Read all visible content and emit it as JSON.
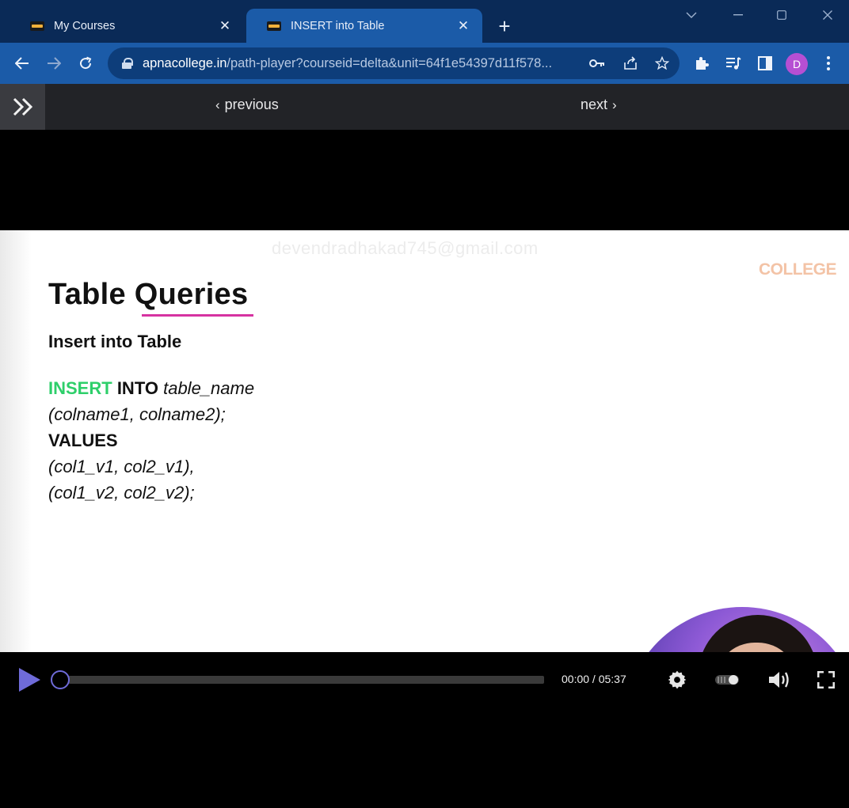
{
  "browser": {
    "tabs": [
      {
        "title": "My Courses",
        "active": false
      },
      {
        "title": "INSERT into Table",
        "active": true
      }
    ],
    "url_host": "apnacollege.in",
    "url_path": "/path-player?courseid=delta&unit=64f1e54397d11f578...",
    "profile_initial": "D",
    "colors": {
      "tabstrip": "#0a2a57",
      "toolbar": "#1b5ba8",
      "profile": "#b64fd3"
    }
  },
  "player_nav": {
    "previous_label": "previous",
    "next_label": "next"
  },
  "slide": {
    "watermark": "devendradhakad745@gmail.com",
    "brand": "COLLEGE",
    "title_part1": "Table ",
    "title_part2": "Queries",
    "subtitle": "Insert into Table",
    "code": {
      "line1_kw1": "INSERT",
      "line1_kw2": "INTO",
      "line1_rest": "table_name",
      "line2": "(colname1, colname2);",
      "line3": "VALUES",
      "line4": "(col1_v1, col2_v1),",
      "line5": "(col1_v2, col2_v2);"
    },
    "colors": {
      "keyword_green": "#2ecf6a",
      "underline": "#d633a1",
      "brand": "#f3c3a6"
    }
  },
  "controls": {
    "time_display": "00:00 / 05:37",
    "progress": 0,
    "accent": "#6f6bd9"
  }
}
